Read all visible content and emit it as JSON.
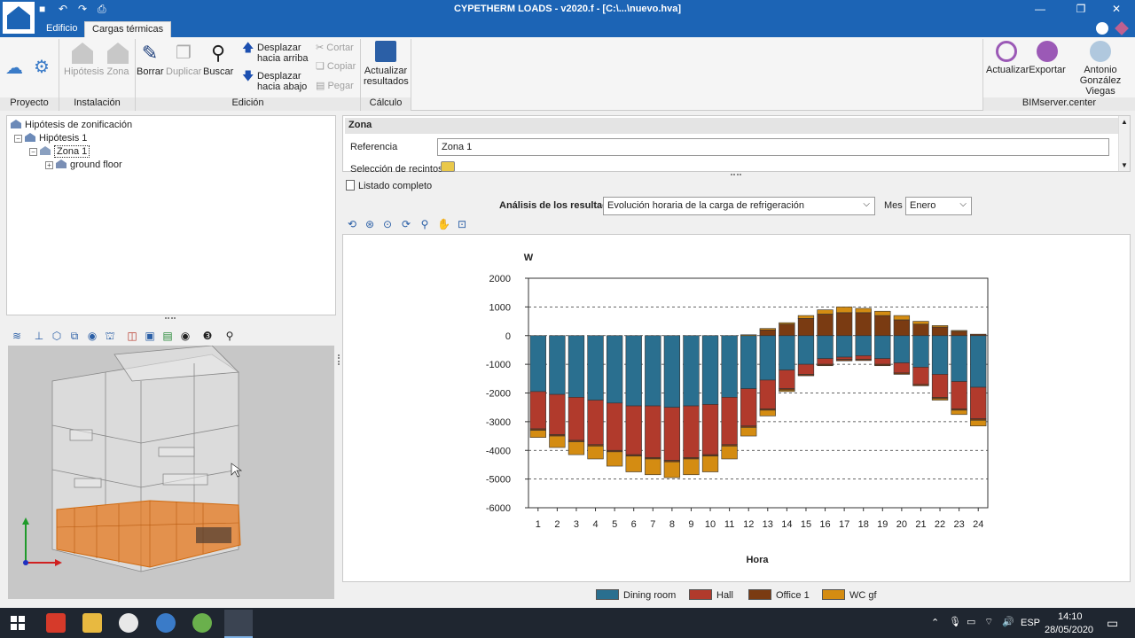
{
  "window": {
    "title": "CYPETHERM LOADS - v2020.f - [C:\\...\\nuevo.hva]"
  },
  "ribbon": {
    "tabs": [
      "Edificio",
      "Cargas térmicas"
    ],
    "groups": {
      "proyecto": "Proyecto",
      "instalacion": "Instalación",
      "edicion": "Edición",
      "calculo": "Cálculo",
      "bim": "BIMserver.center"
    },
    "buttons": {
      "hipotesis": "Hipótesis",
      "zona": "Zona",
      "borrar": "Borrar",
      "duplicar": "Duplicar",
      "buscar": "Buscar",
      "desplazar_arriba_1": "Desplazar",
      "desplazar_arriba_2": "hacia arriba",
      "desplazar_abajo_1": "Desplazar",
      "desplazar_abajo_2": "hacia abajo",
      "cortar": "Cortar",
      "copiar": "Copiar",
      "pegar": "Pegar",
      "actualizar_resultados_1": "Actualizar",
      "actualizar_resultados_2": "resultados",
      "actualizar": "Actualizar",
      "exportar": "Exportar",
      "user_1": "Antonio",
      "user_2": "González Viegas"
    }
  },
  "tree": {
    "root": "Hipótesis de zonificación",
    "hypothesis": "Hipótesis 1",
    "zone": "Zona 1",
    "floor": "ground floor"
  },
  "zone": {
    "header": "Zona",
    "referencia_label": "Referencia",
    "referencia_value": "Zona 1",
    "seleccion_label": "Selección de recintos"
  },
  "listado": "Listado completo",
  "analysis": {
    "label": "Análisis de los resultados",
    "value": "Evolución horaria de la carga de refrigeración",
    "mes_label": "Mes",
    "mes_value": "Enero"
  },
  "colors": {
    "dining": "#2a6f8f",
    "hall": "#b13a2c",
    "office": "#7a3b12",
    "wc": "#d48c12"
  },
  "chart_data": {
    "type": "bar",
    "stacked": true,
    "ylabel": "W",
    "xlabel": "Hora",
    "ylim": [
      -6000,
      2000
    ],
    "yticks": [
      2000,
      1000,
      0,
      -1000,
      -2000,
      -3000,
      -4000,
      -5000,
      -6000
    ],
    "categories": [
      "1",
      "2",
      "3",
      "4",
      "5",
      "6",
      "7",
      "8",
      "9",
      "10",
      "11",
      "12",
      "13",
      "14",
      "15",
      "16",
      "17",
      "18",
      "19",
      "20",
      "21",
      "22",
      "23",
      "24"
    ],
    "series": [
      {
        "name": "Dining room",
        "neg": [
          -1950,
          -2050,
          -2150,
          -2250,
          -2350,
          -2450,
          -2450,
          -2500,
          -2450,
          -2400,
          -2150,
          -1850,
          -1550,
          -1200,
          -1000,
          -800,
          -750,
          -700,
          -800,
          -950,
          -1100,
          -1350,
          -1600,
          -1800
        ],
        "pos": [
          0,
          0,
          0,
          0,
          0,
          0,
          0,
          0,
          0,
          0,
          0,
          0,
          0,
          0,
          0,
          0,
          0,
          0,
          0,
          0,
          0,
          0,
          0,
          0
        ]
      },
      {
        "name": "Hall",
        "neg": [
          -1300,
          -1400,
          -1500,
          -1550,
          -1650,
          -1700,
          -1800,
          -1850,
          -1800,
          -1750,
          -1650,
          -1300,
          -1000,
          -650,
          -350,
          -200,
          -80,
          -120,
          -200,
          -350,
          -600,
          -800,
          -950,
          -1100
        ],
        "pos": [
          0,
          0,
          0,
          0,
          0,
          0,
          0,
          0,
          0,
          0,
          0,
          0,
          0,
          0,
          0,
          0,
          0,
          0,
          0,
          0,
          0,
          0,
          0,
          0
        ]
      },
      {
        "name": "Office 1",
        "neg": [
          -50,
          -50,
          -50,
          -50,
          -50,
          -50,
          -50,
          -50,
          -50,
          -50,
          -50,
          -50,
          -50,
          -50,
          -50,
          -50,
          -50,
          -50,
          -50,
          -50,
          -50,
          -50,
          -50,
          -50
        ],
        "pos": [
          0,
          0,
          0,
          0,
          0,
          0,
          0,
          0,
          0,
          0,
          0,
          0,
          200,
          400,
          600,
          750,
          800,
          800,
          700,
          550,
          400,
          300,
          150,
          50
        ]
      },
      {
        "name": "WC gf",
        "neg": [
          -250,
          -400,
          -450,
          -450,
          -500,
          -550,
          -550,
          -550,
          -550,
          -550,
          -450,
          -300,
          -200,
          -50,
          0,
          0,
          0,
          0,
          0,
          0,
          0,
          -50,
          -150,
          -200
        ],
        "pos": [
          0,
          0,
          0,
          0,
          0,
          0,
          0,
          0,
          0,
          0,
          0,
          30,
          50,
          50,
          100,
          150,
          200,
          150,
          150,
          150,
          100,
          50,
          30,
          0
        ]
      }
    ]
  },
  "taskbar": {
    "lang": "ESP",
    "time": "14:10",
    "date": "28/05/2020"
  }
}
